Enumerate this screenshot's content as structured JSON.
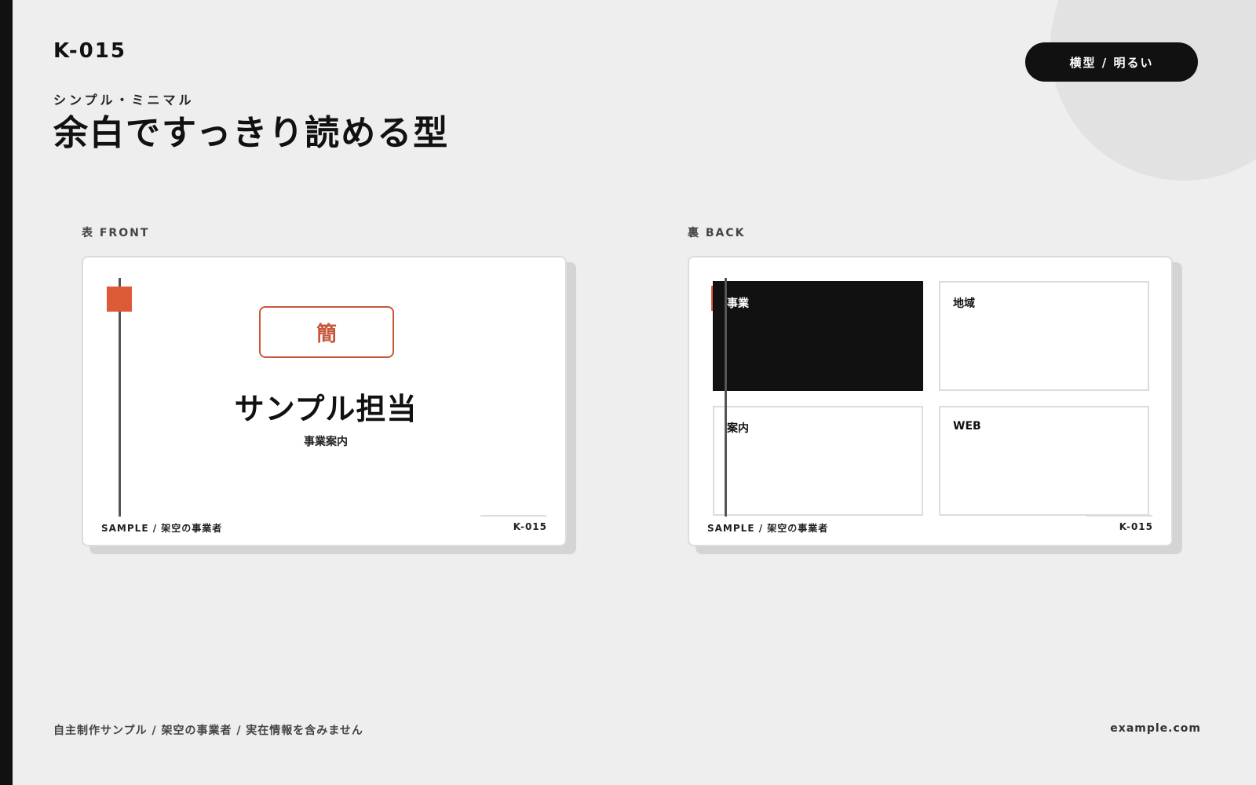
{
  "header": {
    "code": "K-015",
    "subtitle": "シンプル・ミニマル",
    "title": "余白ですっきり読める型",
    "tag_label": "横型 / 明るい"
  },
  "front": {
    "label": "表 FRONT",
    "badge": "簡",
    "name": "サンプル担当",
    "role": "事業案内",
    "footer_left": "SAMPLE / 架空の事業者",
    "footer_right": "K-015"
  },
  "back": {
    "label": "裏 BACK",
    "cells": [
      {
        "label": "事業"
      },
      {
        "label": "地域"
      },
      {
        "label": "案内"
      },
      {
        "label": "WEB"
      }
    ],
    "footer_left": "SAMPLE / 架空の事業者",
    "footer_right": "K-015"
  },
  "footer": {
    "left": "自主制作サンプル / 架空の事業者 / 実在情報を含みません",
    "right": "example.com"
  },
  "colors": {
    "background": "#eeeeee",
    "dark": "#111111",
    "accent": "#dd5a37",
    "card": "#ffffff"
  }
}
